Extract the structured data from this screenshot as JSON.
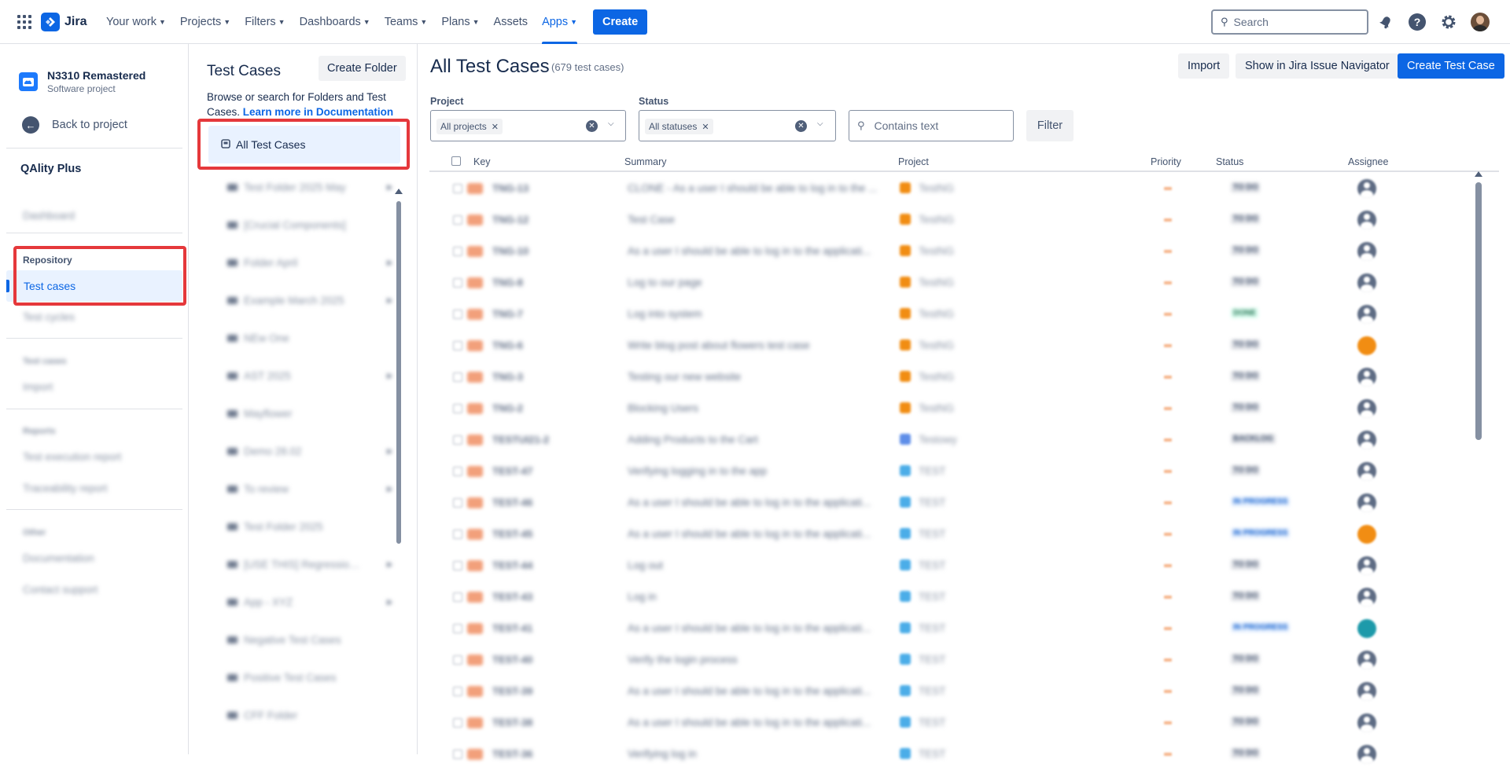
{
  "topnav": {
    "logo_text": "Jira",
    "items": [
      {
        "label": "Your work",
        "has_chevron": true
      },
      {
        "label": "Projects",
        "has_chevron": true
      },
      {
        "label": "Filters",
        "has_chevron": true
      },
      {
        "label": "Dashboards",
        "has_chevron": true
      },
      {
        "label": "Teams",
        "has_chevron": true
      },
      {
        "label": "Plans",
        "has_chevron": true
      },
      {
        "label": "Assets",
        "has_chevron": false
      },
      {
        "label": "Apps",
        "has_chevron": true,
        "active": true
      }
    ],
    "create_label": "Create",
    "search_placeholder": "Search",
    "icons": [
      "apps-grid-icon",
      "notifications-icon",
      "help-icon",
      "settings-icon",
      "user-avatar"
    ],
    "accent_color": "#0c66e4"
  },
  "sidebar": {
    "project_name": "N3310 Remastered",
    "project_type": "Software project",
    "back_label": "Back to project",
    "app_title": "QAlity Plus",
    "items": {
      "dashboard": "Dashboard",
      "repository_header": "Repository",
      "test_cases": "Test cases",
      "test_cycles": "Test cycles",
      "test_cases_header": "Test cases",
      "import": "Import",
      "reports_header": "Reports",
      "test_execution_report": "Test execution report",
      "traceability_report": "Traceability report",
      "other_header": "Other",
      "documentation": "Documentation",
      "contact_support": "Contact support"
    },
    "highlight_color": "#e5383b"
  },
  "folders": {
    "title": "Test Cases",
    "create_folder_label": "Create Folder",
    "description": "Browse or search for Folders and Test Cases.",
    "description_link": "Learn more in Documentation",
    "all_label": "All Test Cases",
    "list": [
      {
        "name": "Test Folder 2025 May",
        "expandable": true
      },
      {
        "name": "[Crucial Components]",
        "expandable": false
      },
      {
        "name": "Folder April",
        "expandable": true
      },
      {
        "name": "Example March 2025",
        "expandable": true
      },
      {
        "name": "NEw One",
        "expandable": false
      },
      {
        "name": "AST 2025",
        "expandable": true
      },
      {
        "name": "Mayflower",
        "expandable": false
      },
      {
        "name": "Demo 28.02",
        "expandable": true
      },
      {
        "name": "To review",
        "expandable": true
      },
      {
        "name": "Test Folder 2025",
        "expandable": false
      },
      {
        "name": "[USE THIS] Regression...",
        "expandable": true
      },
      {
        "name": "App - XYZ",
        "expandable": true
      },
      {
        "name": "Negative Test Cases",
        "expandable": false
      },
      {
        "name": "Positive Test Cases",
        "expandable": false
      },
      {
        "name": "CFF Folder",
        "expandable": false
      }
    ]
  },
  "main": {
    "title": "All Test Cases",
    "count": "(679 test cases)",
    "import_label": "Import",
    "navigator_label": "Show in Jira Issue Navigator",
    "create_label": "Create Test Case",
    "filters": {
      "project_label": "Project",
      "project_tag": "All projects",
      "status_label": "Status",
      "status_tag": "All statuses",
      "text_placeholder": "Contains text",
      "filter_button": "Filter"
    },
    "columns": {
      "key": "Key",
      "summary": "Summary",
      "project": "Project",
      "priority": "Priority",
      "status": "Status",
      "assignee": "Assignee"
    },
    "rows": [
      {
        "key": "TNG-13",
        "summary": "CLONE - As a user I should be able to log in to the ...",
        "project": "TestNG",
        "project_color": "#f18d13",
        "status": "TO DO",
        "status_color": "#44546f",
        "status_bg": "#dfe1e6",
        "avatar": "default"
      },
      {
        "key": "TNG-12",
        "summary": "Test Case",
        "project": "TestNG",
        "project_color": "#f18d13",
        "status": "TO DO",
        "status_color": "#44546f",
        "status_bg": "#dfe1e6",
        "avatar": "default"
      },
      {
        "key": "TNG-10",
        "summary": "As a user I should be able to log in to the applicati...",
        "project": "TestNG",
        "project_color": "#f18d13",
        "status": "TO DO",
        "status_color": "#44546f",
        "status_bg": "#dfe1e6",
        "avatar": "default"
      },
      {
        "key": "TNG-8",
        "summary": "Log to our page",
        "project": "TestNG",
        "project_color": "#f18d13",
        "status": "TO DO",
        "status_color": "#44546f",
        "status_bg": "#dfe1e6",
        "avatar": "default"
      },
      {
        "key": "TNG-7",
        "summary": "Log into system",
        "project": "TestNG",
        "project_color": "#f18d13",
        "status": "DONE",
        "status_color": "#216e4e",
        "status_bg": "#dcfff1",
        "avatar": "default"
      },
      {
        "key": "TNG-6",
        "summary": "Write blog post about flowers test case",
        "project": "TestNG",
        "project_color": "#f18d13",
        "status": "TO DO",
        "status_color": "#44546f",
        "status_bg": "#dfe1e6",
        "avatar": "orange"
      },
      {
        "key": "TNG-3",
        "summary": "Testing our new website",
        "project": "TestNG",
        "project_color": "#f18d13",
        "status": "TO DO",
        "status_color": "#44546f",
        "status_bg": "#dfe1e6",
        "avatar": "default"
      },
      {
        "key": "TNG-2",
        "summary": "Blocking Users",
        "project": "TestNG",
        "project_color": "#f18d13",
        "status": "TO DO",
        "status_color": "#44546f",
        "status_bg": "#dfe1e6",
        "avatar": "default"
      },
      {
        "key": "TESTUI21-2",
        "summary": "Adding Products to the Cart",
        "project": "Testowy",
        "project_color": "#5e8ee8",
        "status": "BACKLOG",
        "status_color": "#44546f",
        "status_bg": "#dfe1e6",
        "avatar": "default"
      },
      {
        "key": "TEST-47",
        "summary": "Verifying logging in to the app",
        "project": "TEST",
        "project_color": "#4bade8",
        "status": "TO DO",
        "status_color": "#44546f",
        "status_bg": "#dfe1e6",
        "avatar": "default"
      },
      {
        "key": "TEST-46",
        "summary": "As a user I should be able to log in to the applicati...",
        "project": "TEST",
        "project_color": "#4bade8",
        "status": "IN PROGRESS",
        "status_color": "#0055cc",
        "status_bg": "#e9f2ff",
        "avatar": "default"
      },
      {
        "key": "TEST-45",
        "summary": "As a user I should be able to log in to the applicati...",
        "project": "TEST",
        "project_color": "#4bade8",
        "status": "IN PROGRESS",
        "status_color": "#0055cc",
        "status_bg": "#e9f2ff",
        "avatar": "orange"
      },
      {
        "key": "TEST-44",
        "summary": "Log out",
        "project": "TEST",
        "project_color": "#4bade8",
        "status": "TO DO",
        "status_color": "#44546f",
        "status_bg": "#dfe1e6",
        "avatar": "default"
      },
      {
        "key": "TEST-43",
        "summary": "Log in",
        "project": "TEST",
        "project_color": "#4bade8",
        "status": "TO DO",
        "status_color": "#44546f",
        "status_bg": "#dfe1e6",
        "avatar": "default"
      },
      {
        "key": "TEST-41",
        "summary": "As a user I should be able to log in to the applicati...",
        "project": "TEST",
        "project_color": "#4bade8",
        "status": "IN PROGRESS",
        "status_color": "#0055cc",
        "status_bg": "#e9f2ff",
        "avatar": "teal"
      },
      {
        "key": "TEST-40",
        "summary": "Verify the login process",
        "project": "TEST",
        "project_color": "#4bade8",
        "status": "TO DO",
        "status_color": "#44546f",
        "status_bg": "#dfe1e6",
        "avatar": "default"
      },
      {
        "key": "TEST-39",
        "summary": "As a user I should be able to log in to the applicati...",
        "project": "TEST",
        "project_color": "#4bade8",
        "status": "TO DO",
        "status_color": "#44546f",
        "status_bg": "#dfe1e6",
        "avatar": "default"
      },
      {
        "key": "TEST-38",
        "summary": "As a user I should be able to log in to the applicati...",
        "project": "TEST",
        "project_color": "#4bade8",
        "status": "TO DO",
        "status_color": "#44546f",
        "status_bg": "#dfe1e6",
        "avatar": "default"
      },
      {
        "key": "TEST-36",
        "summary": "Verifying log in",
        "project": "TEST",
        "project_color": "#4bade8",
        "status": "TO DO",
        "status_color": "#44546f",
        "status_bg": "#dfe1e6",
        "avatar": "default"
      }
    ]
  }
}
